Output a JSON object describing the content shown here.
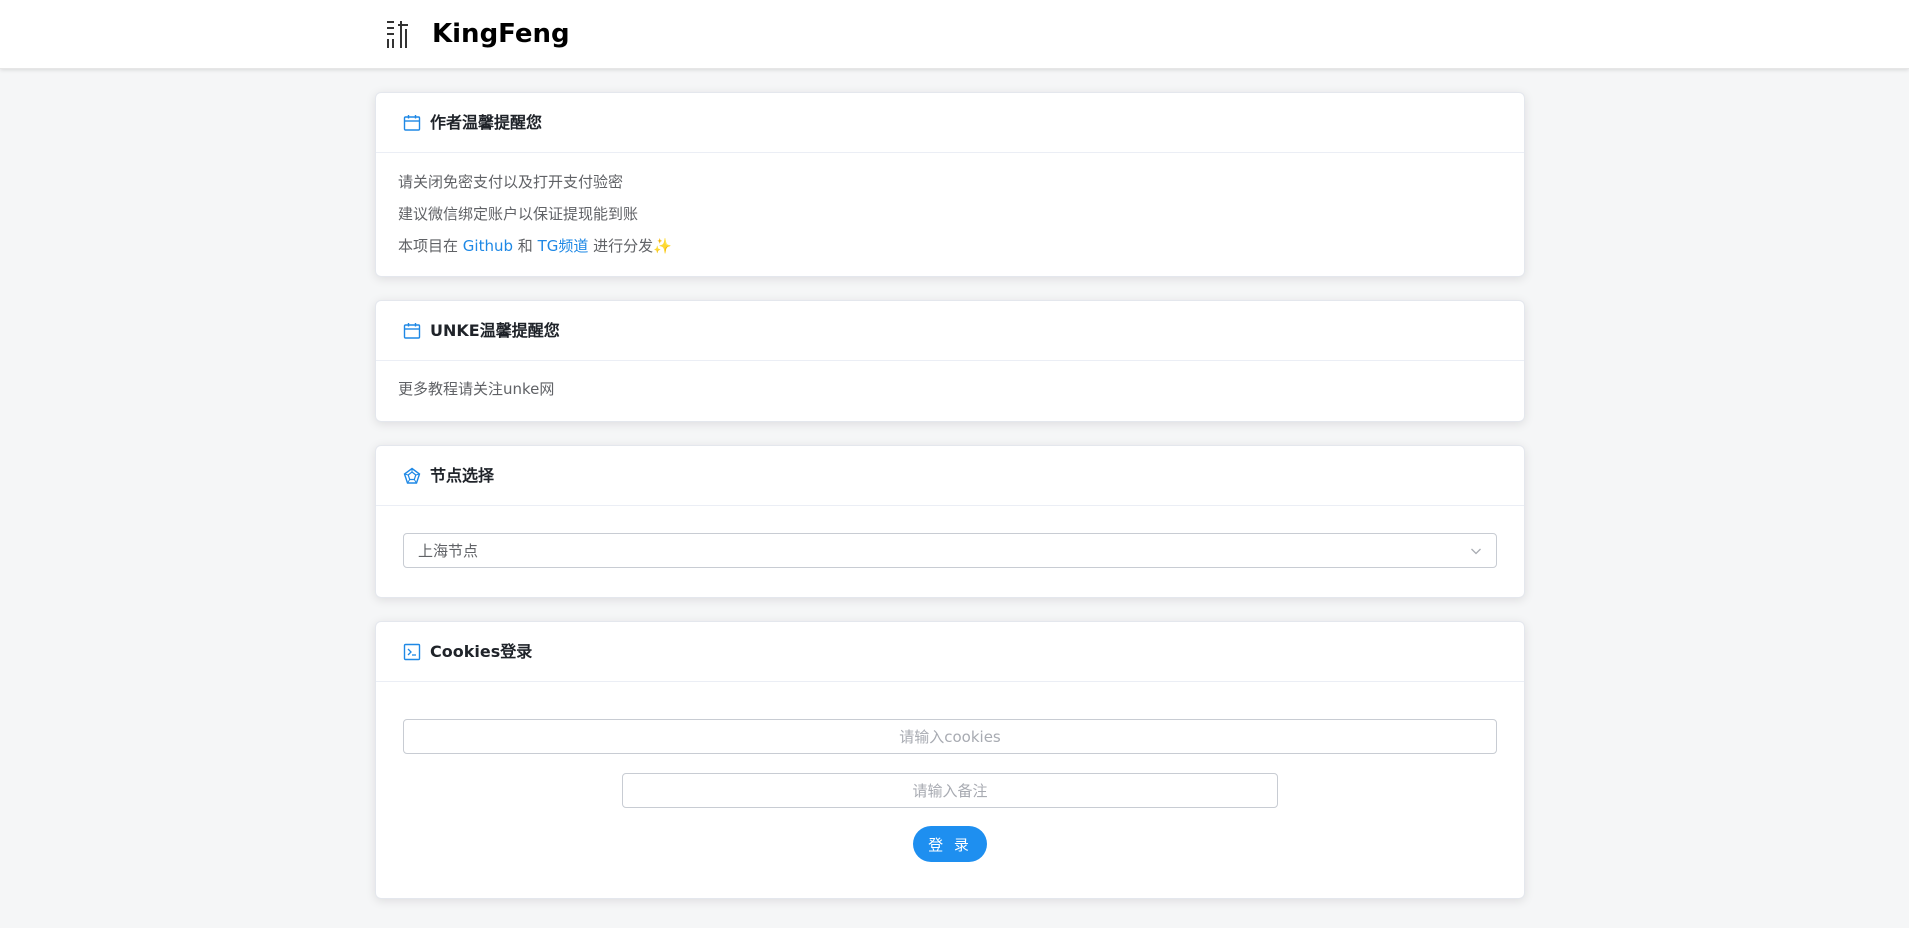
{
  "header": {
    "logo_icon": "kingfeng-logo-icon",
    "brand": "KingFeng"
  },
  "accent_color": "#1e88e5",
  "cards": {
    "author": {
      "icon": "calendar-icon",
      "title": "作者温馨提醒您",
      "line1": "请关闭免密支付以及打开支付验密",
      "line2": "建议微信绑定账户以保证提现能到账",
      "line3_prefix": "本项目在",
      "line3_link1": "Github",
      "line3_and": "和",
      "line3_link2": "TG频道",
      "line3_suffix": "进行分发",
      "line3_emoji": "✨"
    },
    "unke": {
      "icon": "calendar-icon",
      "title": "UNKE温馨提醒您",
      "line1": "更多教程请关注unke网"
    },
    "node": {
      "icon": "pentagon-gem-icon",
      "title": "节点选择",
      "selected": "上海节点",
      "dropdown_icon": "chevron-down-icon"
    },
    "cookies": {
      "icon": "terminal-icon",
      "title": "Cookies登录",
      "cookies_placeholder": "请输入cookies",
      "remark_placeholder": "请输入备注",
      "login_label": "登 录"
    }
  }
}
